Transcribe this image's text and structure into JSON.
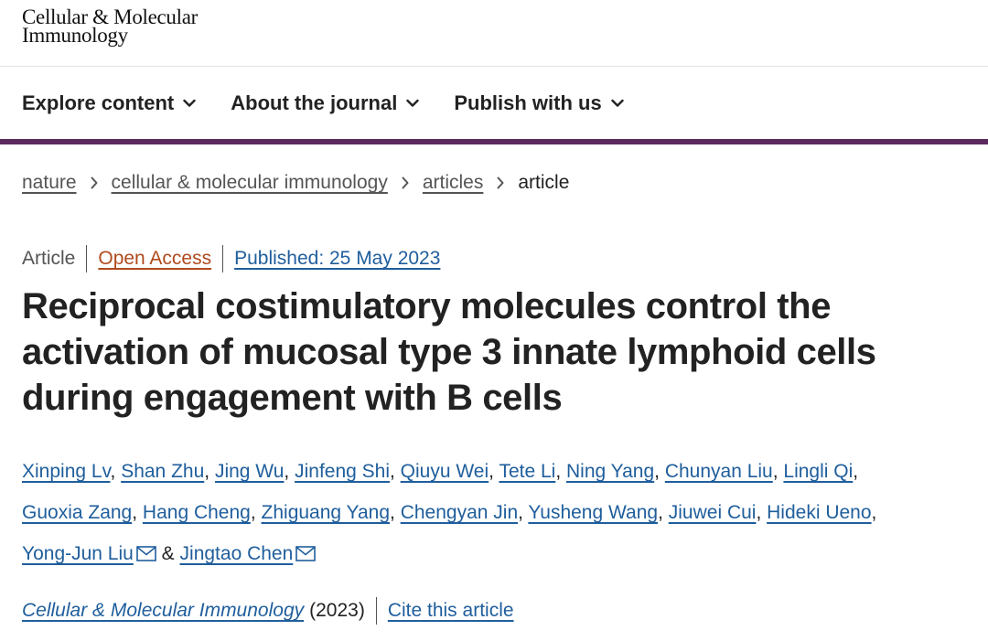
{
  "header": {
    "logo_line1": "Cellular & Molecular",
    "logo_line2": "Immunology"
  },
  "nav": {
    "items": [
      {
        "label": "Explore content",
        "icon": "chevron-down-icon"
      },
      {
        "label": "About the journal",
        "icon": "chevron-down-icon"
      },
      {
        "label": "Publish with us",
        "icon": "chevron-down-icon"
      }
    ]
  },
  "breadcrumb": {
    "items": [
      "nature",
      "cellular & molecular immunology",
      "articles"
    ],
    "current": "article"
  },
  "article_meta": {
    "type": "Article",
    "access": "Open Access",
    "published": "Published: 25 May 2023"
  },
  "article": {
    "title": "Reciprocal costimulatory molecules control the activation of mucosal type 3 innate lymphoid cells during engagement with B cells"
  },
  "authors": [
    "Xinping Lv",
    "Shan Zhu",
    "Jing Wu",
    "Jinfeng Shi",
    "Qiuyu Wei",
    "Tete Li",
    "Ning Yang",
    "Chunyan Liu",
    "Lingli Qi",
    "Guoxia Zang",
    "Hang Cheng",
    "Zhiguang Yang",
    "Chengyan Jin",
    "Yusheng Wang",
    "Jiuwei Cui",
    "Hideki Ueno",
    "Yong-Jun Liu",
    "Jingtao Chen"
  ],
  "authors_conj": "&",
  "citation": {
    "journal": "Cellular & Molecular Immunology",
    "year": "(2023)",
    "cite_label": "Cite this article"
  },
  "colors": {
    "brand_bar": "#5a2a5e",
    "link": "#1f5e9c",
    "open_access": "#b04a1c"
  }
}
